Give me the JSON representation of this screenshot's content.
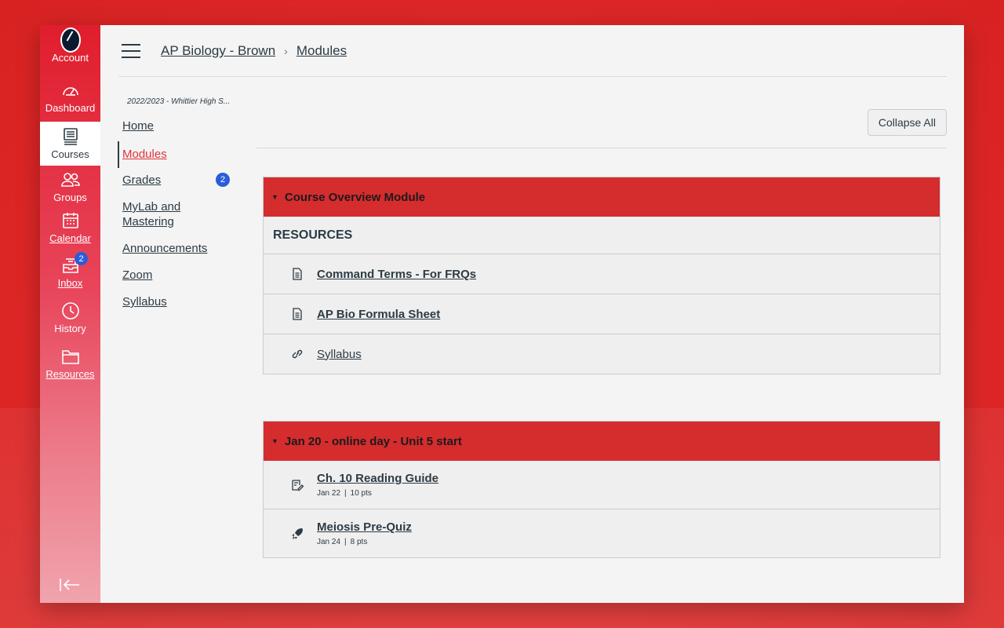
{
  "global_nav": {
    "items": [
      {
        "label": "Account",
        "icon": "account-avatar"
      },
      {
        "label": "Dashboard",
        "icon": "dashboard-icon"
      },
      {
        "label": "Courses",
        "icon": "courses-icon"
      },
      {
        "label": "Groups",
        "icon": "groups-icon"
      },
      {
        "label": "Calendar",
        "icon": "calendar-icon"
      },
      {
        "label": "Inbox",
        "icon": "inbox-icon",
        "badge": "2"
      },
      {
        "label": "History",
        "icon": "history-icon"
      },
      {
        "label": "Resources",
        "icon": "folder-icon"
      }
    ]
  },
  "header": {
    "breadcrumb": [
      "AP Biology - Brown",
      "Modules"
    ]
  },
  "course_nav": {
    "term": "2022/2023 - Whittier High S...",
    "items": [
      {
        "label": "Home"
      },
      {
        "label": "Modules"
      },
      {
        "label": "Grades",
        "badge": "2"
      },
      {
        "label": "MyLab and Mastering"
      },
      {
        "label": "Announcements"
      },
      {
        "label": "Zoom"
      },
      {
        "label": "Syllabus"
      }
    ]
  },
  "toolbar": {
    "collapse_all": "Collapse All"
  },
  "modules": [
    {
      "title": "Course Overview Module",
      "subheader": "RESOURCES",
      "items": [
        {
          "title": "Command Terms - For FRQs",
          "icon": "page-icon"
        },
        {
          "title": "AP Bio Formula Sheet",
          "icon": "page-icon"
        },
        {
          "title": "Syllabus",
          "icon": "link-icon"
        }
      ]
    },
    {
      "title": "Jan 20 - online day - Unit 5 start",
      "items": [
        {
          "title": "Ch. 10 Reading Guide",
          "icon": "assignment-icon",
          "due": "Jan 22",
          "points": "10 pts"
        },
        {
          "title": "Meiosis Pre-Quiz",
          "icon": "quiz-icon",
          "due": "Jan 24",
          "points": "8 pts"
        }
      ]
    }
  ],
  "colors": {
    "brand_red": "#e01e2d",
    "module_header": "#d52c2e",
    "badge_blue": "#2b5ddb",
    "active_link": "#e0323a"
  }
}
